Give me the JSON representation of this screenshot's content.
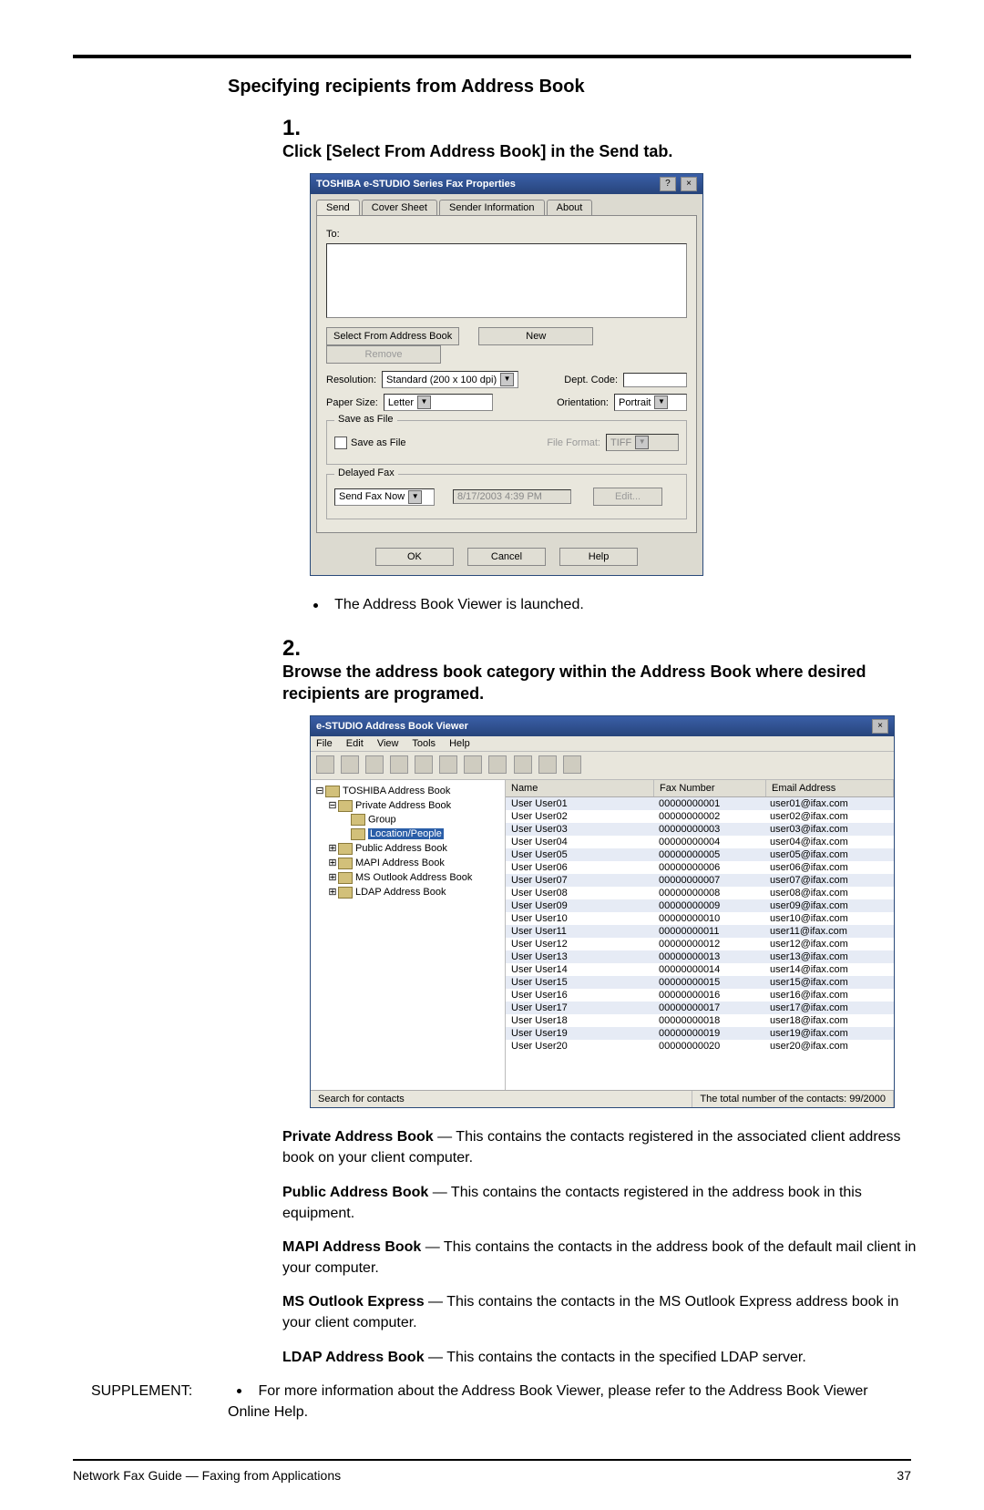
{
  "section_title": "Specifying recipients from Address Book",
  "step1": {
    "num": "1.",
    "text": "Click [Select From Address Book] in the Send tab."
  },
  "step2": {
    "num": "2.",
    "text": "Browse the address book category within the Address Book where desired recipients are programed."
  },
  "after_step1_bullet": "The Address Book Viewer is launched.",
  "dlg1": {
    "title": "TOSHIBA e-STUDIO Series Fax Properties",
    "help_btn": "?",
    "close_btn": "×",
    "tabs": [
      "Send",
      "Cover Sheet",
      "Sender Information",
      "About"
    ],
    "to_label": "To:",
    "btn_select": "Select From Address Book",
    "btn_new": "New",
    "btn_remove": "Remove",
    "resolution_label": "Resolution:",
    "resolution_val": "Standard (200 x 100 dpi)",
    "dept_label": "Dept. Code:",
    "paper_label": "Paper Size:",
    "paper_val": "Letter",
    "orient_label": "Orientation:",
    "orient_val": "Portrait",
    "save_legend": "Save as File",
    "save_chk": "Save as File",
    "fileformat_label": "File Format:",
    "fileformat_val": "TIFF",
    "delayed_legend": "Delayed Fax",
    "delayed_val": "Send Fax Now",
    "delayed_time": "8/17/2003 4:39 PM",
    "btn_edit": "Edit...",
    "btn_ok": "OK",
    "btn_cancel": "Cancel",
    "btn_help": "Help"
  },
  "dlg2": {
    "title": "e-STUDIO Address Book Viewer",
    "close_btn": "×",
    "menu": [
      "File",
      "Edit",
      "View",
      "Tools",
      "Help"
    ],
    "tree": {
      "root": "TOSHIBA Address Book",
      "priv": "Private Address Book",
      "group": "Group",
      "locpeople": "Location/People",
      "pub": "Public Address Book",
      "mapi": "MAPI Address Book",
      "msout": "MS Outlook Address Book",
      "ldap": "LDAP Address Book"
    },
    "headers": {
      "name": "Name",
      "fax": "Fax Number",
      "email": "Email Address"
    },
    "rows": [
      {
        "n": "User User01",
        "f": "00000000001",
        "e": "user01@ifax.com"
      },
      {
        "n": "User User02",
        "f": "00000000002",
        "e": "user02@ifax.com"
      },
      {
        "n": "User User03",
        "f": "00000000003",
        "e": "user03@ifax.com"
      },
      {
        "n": "User User04",
        "f": "00000000004",
        "e": "user04@ifax.com"
      },
      {
        "n": "User User05",
        "f": "00000000005",
        "e": "user05@ifax.com"
      },
      {
        "n": "User User06",
        "f": "00000000006",
        "e": "user06@ifax.com"
      },
      {
        "n": "User User07",
        "f": "00000000007",
        "e": "user07@ifax.com"
      },
      {
        "n": "User User08",
        "f": "00000000008",
        "e": "user08@ifax.com"
      },
      {
        "n": "User User09",
        "f": "00000000009",
        "e": "user09@ifax.com"
      },
      {
        "n": "User User10",
        "f": "00000000010",
        "e": "user10@ifax.com"
      },
      {
        "n": "User User11",
        "f": "00000000011",
        "e": "user11@ifax.com"
      },
      {
        "n": "User User12",
        "f": "00000000012",
        "e": "user12@ifax.com"
      },
      {
        "n": "User User13",
        "f": "00000000013",
        "e": "user13@ifax.com"
      },
      {
        "n": "User User14",
        "f": "00000000014",
        "e": "user14@ifax.com"
      },
      {
        "n": "User User15",
        "f": "00000000015",
        "e": "user15@ifax.com"
      },
      {
        "n": "User User16",
        "f": "00000000016",
        "e": "user16@ifax.com"
      },
      {
        "n": "User User17",
        "f": "00000000017",
        "e": "user17@ifax.com"
      },
      {
        "n": "User User18",
        "f": "00000000018",
        "e": "user18@ifax.com"
      },
      {
        "n": "User User19",
        "f": "00000000019",
        "e": "user19@ifax.com"
      },
      {
        "n": "User User20",
        "f": "00000000020",
        "e": "user20@ifax.com"
      }
    ],
    "status_left": "Search for contacts",
    "status_right": "The total number of the contacts: 99/2000"
  },
  "paras": {
    "priv_t": "Private Address Book",
    "priv_b": " — This contains the contacts registered in the associated client address book on your client computer.",
    "pub_t": "Public Address Book",
    "pub_b": " — This contains the contacts registered in the address book in this equipment.",
    "mapi_t": "MAPI Address Book",
    "mapi_b": " — This contains the contacts in the address book of the default mail client in your computer.",
    "ms_t": "MS Outlook Express",
    "ms_b": " — This contains the contacts in the MS Outlook Express address book in your client computer.",
    "ldap_t": "LDAP Address Book",
    "ldap_b": " — This contains the contacts in the specified LDAP server."
  },
  "supplement": {
    "label": "SUPPLEMENT:",
    "text": "For more information about the Address Book Viewer, please refer to the Address Book Viewer Online Help."
  },
  "footer": {
    "left": "Network Fax Guide — Faxing from Applications",
    "right": "37"
  }
}
